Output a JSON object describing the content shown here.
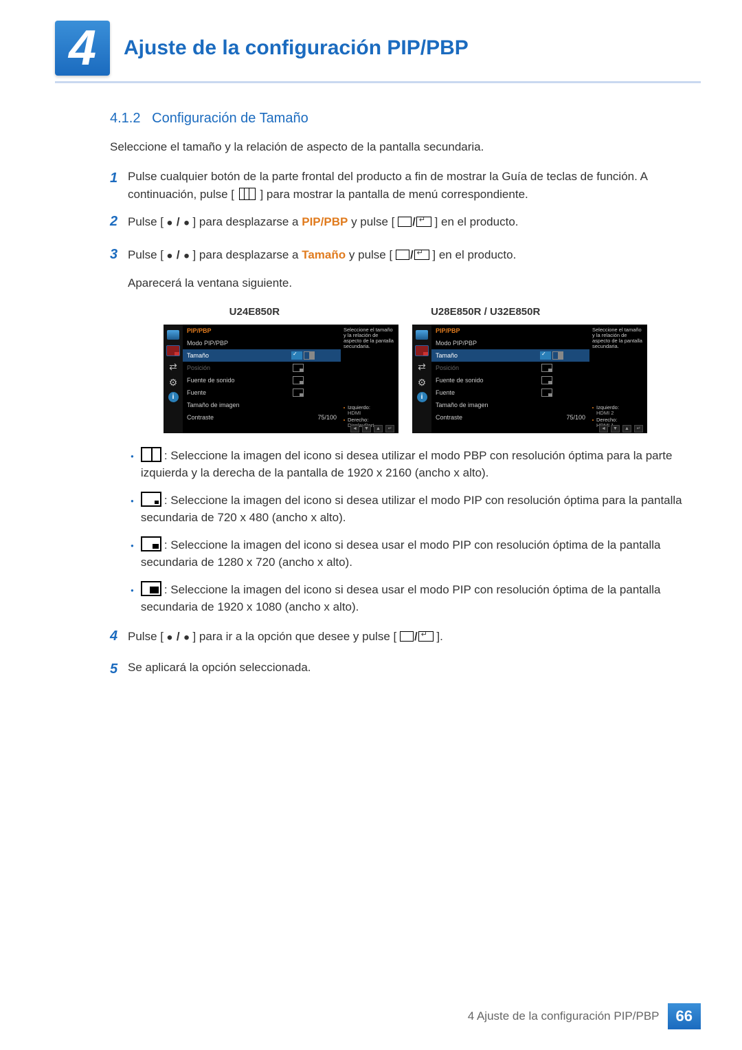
{
  "chapter_number": "4",
  "chapter_title": "Ajuste de la configuración PIP/PBP",
  "section_number": "4.1.2",
  "section_title": "Configuración de Tamaño",
  "intro": "Seleccione el tamaño y la relación de aspecto de la pantalla secundaria.",
  "step1_a": "Pulse cualquier botón de la parte frontal del producto a fin de mostrar la Guía de teclas de función. A continuación, pulse [",
  "step1_b": "] para mostrar la pantalla de menú correspondiente.",
  "step2_a": "Pulse [",
  "step2_b": "] para desplazarse a ",
  "step2_c": " y pulse [",
  "step2_d": "] en el producto.",
  "step2_hl": "PIP/PBP",
  "step3_a": "Pulse [",
  "step3_b": "] para desplazarse a ",
  "step3_c": " y pulse [",
  "step3_d": "] en el producto.",
  "step3_hl": "Tamaño",
  "step3_after": "Aparecerá la ventana siguiente.",
  "model_left": "U24E850R",
  "model_right": "U28E850R / U32E850R",
  "osd": {
    "title": "PIP/PBP",
    "rows": [
      {
        "label": "Modo PIP/PBP"
      },
      {
        "label": "Tamaño",
        "selected": true
      },
      {
        "label": "Posición",
        "dim": true
      },
      {
        "label": "Fuente de sonido"
      },
      {
        "label": "Fuente"
      },
      {
        "label": "Tamaño de imagen"
      },
      {
        "label": "Contraste",
        "value": "75/100"
      }
    ],
    "help_top": "Seleccione el tamaño y la relación de aspecto de la pantalla secundaria.",
    "left_help": [
      {
        "name": "Izquierdo:",
        "sub": "HDMI"
      },
      {
        "name": "Derecho:",
        "sub": "DisplayPort"
      }
    ],
    "right_help": [
      {
        "name": "Izquierdo:",
        "sub": "HDMI 2"
      },
      {
        "name": "Derecho:",
        "sub": "HDMI 1"
      }
    ]
  },
  "bullets": [
    ": Seleccione la imagen del icono si desea utilizar el modo PBP con resolución óptima para la parte izquierda y la derecha de la pantalla de 1920 x 2160 (ancho x alto).",
    ": Seleccione la imagen del icono si desea utilizar el modo PIP con resolución óptima para la pantalla secundaria de 720 x 480 (ancho x alto).",
    ": Seleccione la imagen del icono si desea usar el modo PIP con resolución óptima de la pantalla secundaria de 1280 x 720 (ancho x alto).",
    ": Seleccione la imagen del icono si desea usar el modo PIP con resolución óptima de la pantalla secundaria de 1920 x 1080 (ancho x alto)."
  ],
  "step4_a": "Pulse [",
  "step4_b": "] para ir a la opción que desee y pulse [",
  "step4_c": "].",
  "step5": "Se aplicará la opción seleccionada.",
  "footer_text": "4 Ajuste de la configuración PIP/PBP",
  "footer_page": "66"
}
